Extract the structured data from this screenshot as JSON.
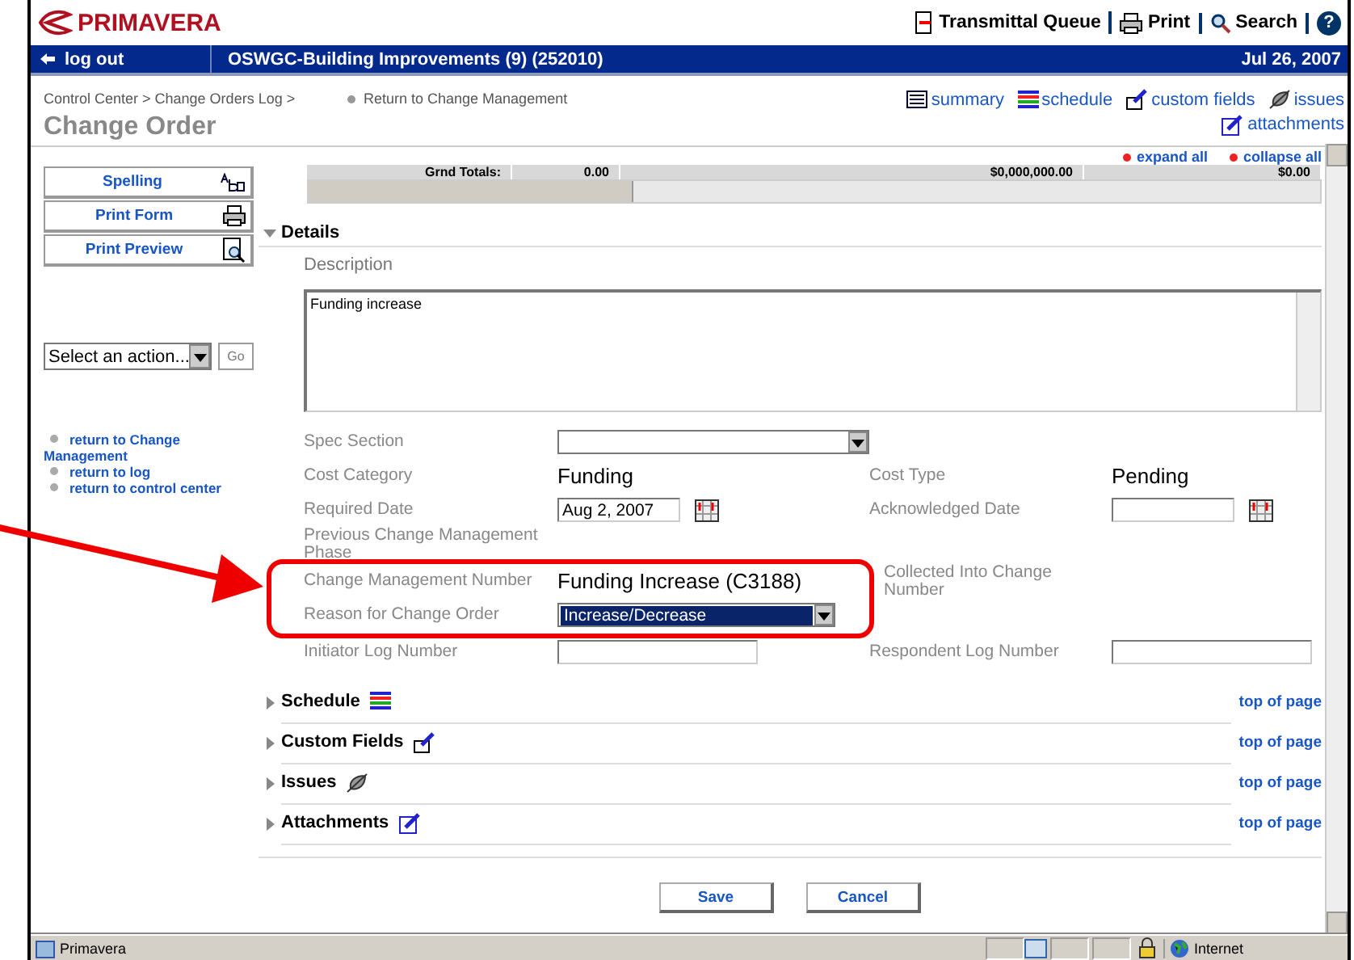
{
  "header": {
    "logo": "PRIMAVERA",
    "links": [
      {
        "label": "Transmittal Queue"
      },
      {
        "label": "Print"
      },
      {
        "label": "Search"
      }
    ],
    "help": "?"
  },
  "bar": {
    "logout": "log out",
    "project": "OSWGC-Building Improvements (9) (252010)",
    "date": "Jul 26, 2007"
  },
  "breadcrumb": {
    "path": "Control Center > Change Orders Log >",
    "return_link": "Return to Change Management",
    "title": "Change Order"
  },
  "quick_links": [
    {
      "label": "summary"
    },
    {
      "label": "schedule"
    },
    {
      "label": "custom fields"
    },
    {
      "label": "issues"
    },
    {
      "label": "attachments"
    }
  ],
  "sidebar": {
    "buttons": [
      {
        "label": "Spelling"
      },
      {
        "label": "Print Form"
      },
      {
        "label": "Print Preview"
      }
    ],
    "action_select": {
      "value": "Select an action..."
    },
    "go": "Go",
    "links": [
      "return to Change Management",
      "return to log",
      "return to control center"
    ]
  },
  "expand_all": "expand all",
  "collapse_all": "collapse all",
  "totals": {
    "label": "Grnd Totals:",
    "values": [
      "0.00",
      "$0,000,000.00",
      "$0.00"
    ]
  },
  "details": {
    "title": "Details",
    "expanded": true,
    "description_label": "Description",
    "description": "Funding increase",
    "rows": [
      [
        {
          "label": "Spec Section",
          "kind": "select"
        }
      ],
      [
        {
          "label": "Cost Category",
          "kind": "text",
          "value": "Funding"
        },
        {
          "label": "Cost Type",
          "kind": "text",
          "value": "Pending"
        }
      ],
      [
        {
          "label": "Required Date",
          "kind": "date",
          "value": "Aug 2, 2007"
        },
        {
          "label": "Acknowledged Date",
          "kind": "date"
        }
      ],
      [
        {
          "label": "Previous Change Management Phase",
          "kind": "none"
        }
      ],
      [
        {
          "label": "Change Management Number",
          "kind": "text",
          "value": "Funding Increase (C3188)"
        },
        {
          "label": "Collected Into Change Number",
          "kind": "none"
        }
      ],
      [
        {
          "label": "Reason for Change Order",
          "kind": "select",
          "value": "Increase/Decrease",
          "selected": true
        }
      ],
      [
        {
          "label": "Initiator Log Number",
          "kind": "input"
        },
        {
          "label": "Respondent Log Number",
          "kind": "input"
        }
      ]
    ]
  },
  "sections": [
    {
      "title": "Schedule",
      "expanded": false,
      "link": "top of page"
    },
    {
      "title": "Custom Fields",
      "expanded": false,
      "link": "top of page"
    },
    {
      "title": "Issues",
      "expanded": false,
      "link": "top of page"
    },
    {
      "title": "Attachments",
      "expanded": false,
      "link": "top of page"
    }
  ],
  "buttons": [
    "Save",
    "Cancel"
  ],
  "status_bar": {
    "text": "Primavera",
    "zone": "Internet"
  }
}
